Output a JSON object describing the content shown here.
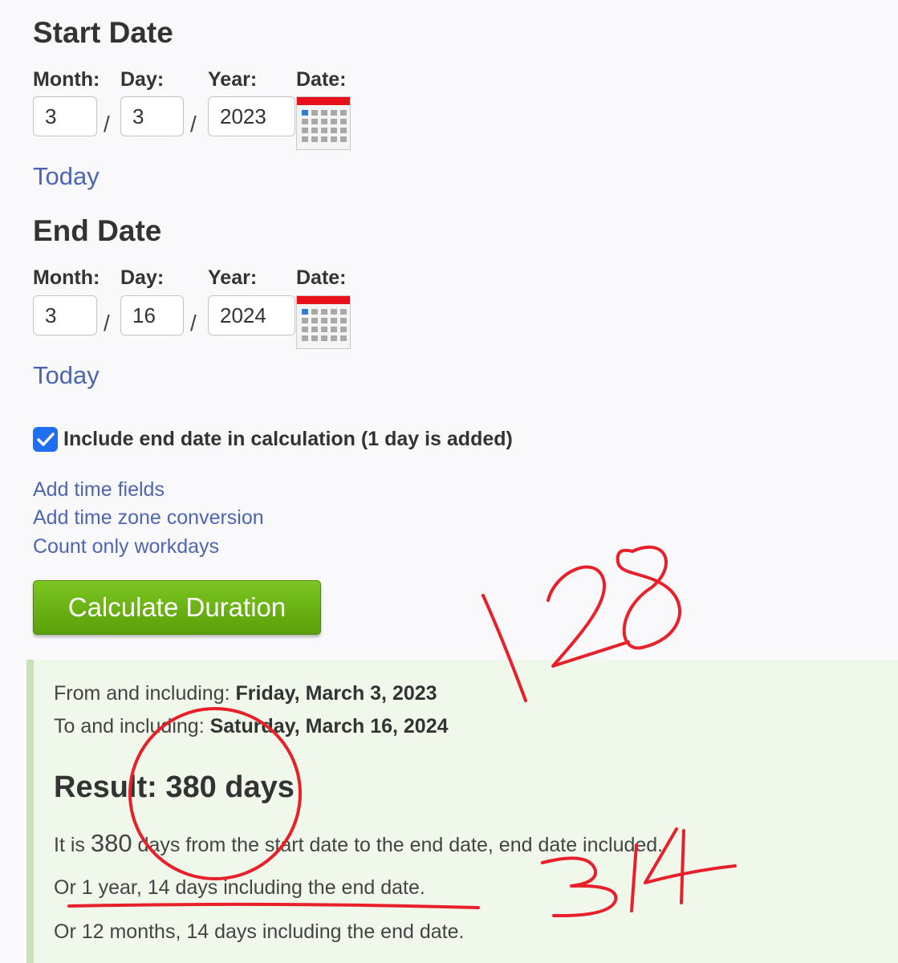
{
  "start": {
    "title": "Start Date",
    "labels": {
      "month": "Month:",
      "day": "Day:",
      "year": "Year:",
      "date": "Date:"
    },
    "month": "3",
    "day": "3",
    "year": "2023",
    "today_link": "Today"
  },
  "end": {
    "title": "End Date",
    "labels": {
      "month": "Month:",
      "day": "Day:",
      "year": "Year:",
      "date": "Date:"
    },
    "month": "3",
    "day": "16",
    "year": "2024",
    "today_link": "Today"
  },
  "separator": "/",
  "include_end": {
    "checked": true,
    "label": "Include end date in calculation (1 day is added)"
  },
  "links": {
    "add_time": "Add time fields",
    "add_timezone": "Add time zone conversion",
    "workdays": "Count only workdays"
  },
  "calculate_button": "Calculate Duration",
  "result": {
    "from_prefix": "From and including: ",
    "from_value": "Friday, March 3, 2023",
    "to_prefix": "To and including: ",
    "to_value": "Saturday, March 16, 2024",
    "heading": "Result: 380 days",
    "line1_prefix": "It is ",
    "line1_number": "380",
    "line1_suffix": " days from the start date to the end date, end date included.",
    "line2": "Or 1 year, 14 days including the end date.",
    "line3": "Or 12 months, 14 days including the end date."
  },
  "annotations": {
    "number_top": "128",
    "number_bottom": "314",
    "ink_color": "#e8202a"
  },
  "colors": {
    "link": "#4d66b3",
    "button_green": "#6bb311",
    "checkbox_blue": "#1f6ff0",
    "calendar_red": "#e8101a",
    "result_bg": "#eff8ea"
  }
}
